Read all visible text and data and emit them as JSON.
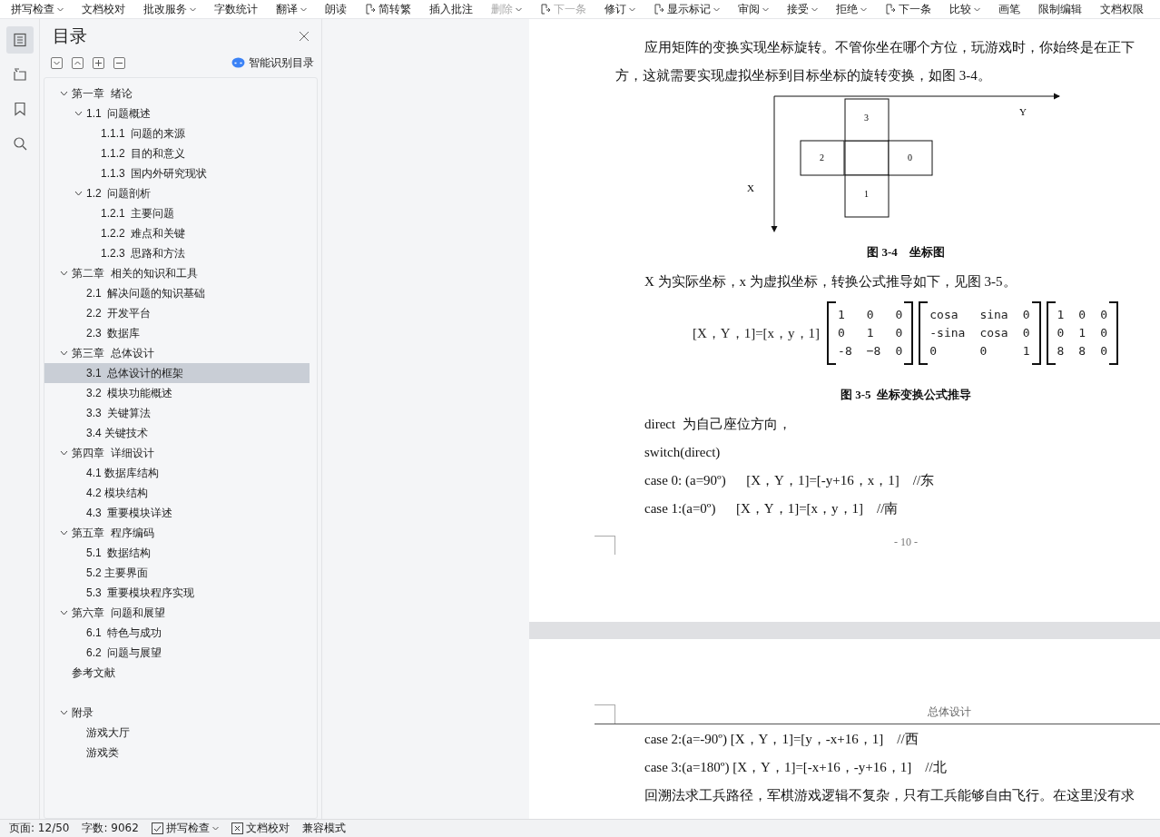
{
  "toolbar": [
    {
      "label": "拼写检查",
      "kind": "text",
      "dropdown": true,
      "disabled": false
    },
    {
      "label": "文档校对",
      "kind": "text",
      "dropdown": false,
      "disabled": false
    },
    {
      "label": "批改服务",
      "kind": "text",
      "dropdown": true,
      "disabled": false
    },
    {
      "label": "字数统计",
      "kind": "text",
      "dropdown": false,
      "disabled": false
    },
    {
      "label": "翻译",
      "kind": "text",
      "dropdown": true,
      "disabled": false
    },
    {
      "label": "朗读",
      "kind": "text",
      "dropdown": false,
      "disabled": false
    },
    {
      "label": "简转繁",
      "kind": "icon",
      "dropdown": false,
      "disabled": false
    },
    {
      "label": "插入批注",
      "kind": "text",
      "dropdown": false,
      "disabled": false
    },
    {
      "label": "删除",
      "kind": "text",
      "dropdown": true,
      "disabled": true
    },
    {
      "label": "下一条",
      "kind": "icon",
      "dropdown": false,
      "disabled": true
    },
    {
      "label": "修订",
      "kind": "text",
      "dropdown": true,
      "disabled": false
    },
    {
      "label": "显示标记",
      "kind": "icon",
      "dropdown": true,
      "disabled": false
    },
    {
      "label": "审阅",
      "kind": "text",
      "dropdown": true,
      "disabled": false
    },
    {
      "label": "接受",
      "kind": "text",
      "dropdown": true,
      "disabled": false
    },
    {
      "label": "拒绝",
      "kind": "text",
      "dropdown": true,
      "disabled": false
    },
    {
      "label": "下一条",
      "kind": "icon",
      "dropdown": false,
      "disabled": false
    },
    {
      "label": "比较",
      "kind": "text",
      "dropdown": true,
      "disabled": false
    },
    {
      "label": "画笔",
      "kind": "text",
      "dropdown": false,
      "disabled": false
    },
    {
      "label": "限制编辑",
      "kind": "text",
      "dropdown": false,
      "disabled": false
    },
    {
      "label": "文档权限",
      "kind": "text",
      "dropdown": false,
      "disabled": false
    }
  ],
  "rail": [
    {
      "kind": "toc",
      "selected": true
    },
    {
      "kind": "outline",
      "selected": false
    },
    {
      "kind": "bookmark",
      "selected": false
    },
    {
      "kind": "search",
      "selected": false
    }
  ],
  "sidebar": {
    "title": "目录",
    "smart_button": "智能识别目录",
    "toc": [
      {
        "label": "第一章  绪论",
        "expanded": true,
        "selected": false,
        "children": [
          {
            "label": "1.1  问题概述",
            "expanded": true,
            "selected": false,
            "children": [
              {
                "label": "1.1.1  问题的来源",
                "selected": false
              },
              {
                "label": "1.1.2  目的和意义",
                "selected": false
              },
              {
                "label": "1.1.3  国内外研究现状",
                "selected": false
              }
            ]
          },
          {
            "label": "1.2  问题剖析",
            "expanded": true,
            "selected": false,
            "children": [
              {
                "label": "1.2.1  主要问题",
                "selected": false
              },
              {
                "label": "1.2.2  难点和关键",
                "selected": false
              },
              {
                "label": "1.2.3  思路和方法",
                "selected": false
              }
            ]
          }
        ]
      },
      {
        "label": "第二章  相关的知识和工具",
        "expanded": true,
        "selected": false,
        "children": [
          {
            "label": "2.1  解决问题的知识基础",
            "selected": false
          },
          {
            "label": "2.2  开发平台",
            "selected": false
          },
          {
            "label": "2.3  数据库",
            "selected": false
          }
        ]
      },
      {
        "label": "第三章  总体设计",
        "expanded": true,
        "selected": false,
        "children": [
          {
            "label": "3.1  总体设计的框架",
            "selected": true
          },
          {
            "label": "3.2  模块功能概述",
            "selected": false
          },
          {
            "label": "3.3  关键算法",
            "selected": false
          },
          {
            "label": "3.4 关键技术",
            "selected": false
          }
        ]
      },
      {
        "label": "第四章  详细设计",
        "expanded": true,
        "selected": false,
        "children": [
          {
            "label": "4.1 数据库结构",
            "selected": false
          },
          {
            "label": "4.2 模块结构",
            "selected": false
          },
          {
            "label": "4.3  重要模块详述",
            "selected": false
          }
        ]
      },
      {
        "label": "第五章  程序编码",
        "expanded": true,
        "selected": false,
        "children": [
          {
            "label": "5.1  数据结构",
            "selected": false
          },
          {
            "label": "5.2 主要界面",
            "selected": false
          },
          {
            "label": "5.3  重要模块程序实现",
            "selected": false
          }
        ]
      },
      {
        "label": "第六章  问题和展望",
        "expanded": true,
        "selected": false,
        "children": [
          {
            "label": "6.1  特色与成功",
            "selected": false
          },
          {
            "label": "6.2  问题与展望",
            "selected": false
          }
        ]
      },
      {
        "label": "参考文献",
        "selected": false
      },
      {
        "label": "附录",
        "expanded": true,
        "selected": false,
        "separated": true,
        "children": [
          {
            "label": "游戏大厅",
            "selected": false
          },
          {
            "label": "游戏类",
            "selected": false
          }
        ]
      }
    ]
  },
  "pages": [
    {
      "blocks": [
        {
          "kind": "paragraph",
          "lines": [
            "应用矩阵的变换实现坐标旋转。不管你坐在哪个方位，玩游戏时，你始终是在正下",
            "方，这就需要实现虚拟坐标到目标坐标的旋转变换，如图 3-4。"
          ]
        },
        {
          "kind": "figure",
          "cells": [
            "3",
            "2",
            "0",
            "1"
          ],
          "x_label": "X",
          "y_label": "Y"
        },
        {
          "kind": "caption",
          "text": "图 3-4    坐标图"
        },
        {
          "kind": "paragraph",
          "lines": [
            "X 为实际坐标，x 为虚拟坐标，转换公式推导如下，见图 3-5。"
          ]
        },
        {
          "kind": "formula",
          "lhs": "[X，Y，1]=[x，y，1]",
          "matrices": [
            [
              [
                "1",
                "0",
                "0"
              ],
              [
                "0",
                "1",
                "0"
              ],
              [
                "-8",
                "−8",
                "0"
              ]
            ],
            [
              [
                "cosa",
                "sina",
                "0"
              ],
              [
                "-sina",
                "cosa",
                "0"
              ],
              [
                "0",
                "0",
                "1"
              ]
            ],
            [
              [
                "1",
                "0",
                "0"
              ],
              [
                "0",
                "1",
                "0"
              ],
              [
                "8",
                "8",
                "0"
              ]
            ]
          ]
        },
        {
          "kind": "caption",
          "text": "图 3-5  坐标变换公式推导"
        },
        {
          "kind": "code",
          "text": "direct  为自己座位方向，"
        },
        {
          "kind": "code",
          "text": "switch(direct)"
        },
        {
          "kind": "code",
          "text": "case 0: (a=90º)      [X，Y，1]=[-y+16，x，1]    //东"
        },
        {
          "kind": "code",
          "text": "case 1:(a=0º)      [X，Y，1]=[x，y，1]    //南"
        }
      ],
      "page_number": "- 10 -"
    },
    {
      "header": "总体设计",
      "blocks": [
        {
          "kind": "code",
          "text": "case 2:(a=-90º) [X，Y，1]=[y，-x+16，1]    //西"
        },
        {
          "kind": "code",
          "text": "case 3:(a=180º) [X，Y，1]=[-x+16，-y+16，1]    //北"
        },
        {
          "kind": "paragraph",
          "lines": [
            "回溯法求工兵路径，军棋游戏逻辑不复杂，只有工兵能够自由飞行。在这里没有求"
          ]
        }
      ]
    }
  ],
  "status_bar": {
    "page": "页面: 12/50",
    "words": "字数: 9062",
    "spell": {
      "label": "拼写检查",
      "checked": true,
      "dropdown": true
    },
    "proof": {
      "label": "文档校对"
    },
    "mode": "兼容模式"
  }
}
